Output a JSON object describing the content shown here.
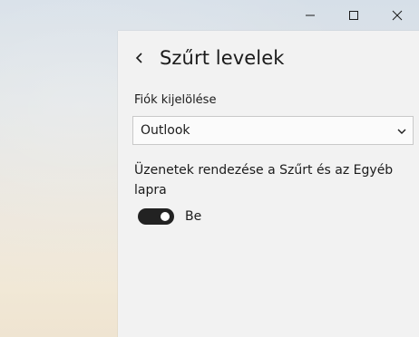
{
  "window_controls": {
    "minimize_icon": "minimize-icon",
    "maximize_icon": "maximize-icon",
    "close_icon": "close-icon"
  },
  "header": {
    "back_icon": "chevron-left-icon",
    "title": "Szűrt levelek"
  },
  "account": {
    "label": "Fiók kijelölése",
    "selected": "Outlook",
    "dropdown_icon": "chevron-down-icon"
  },
  "focused_inbox": {
    "description": "Üzenetek rendezése a Szűrt és az Egyéb lapra",
    "toggle_on": true,
    "toggle_state_label": "Be"
  },
  "colors": {
    "panel_bg": "#f2f2f2",
    "toggle_on": "#222222",
    "text": "#1b1b1b"
  }
}
